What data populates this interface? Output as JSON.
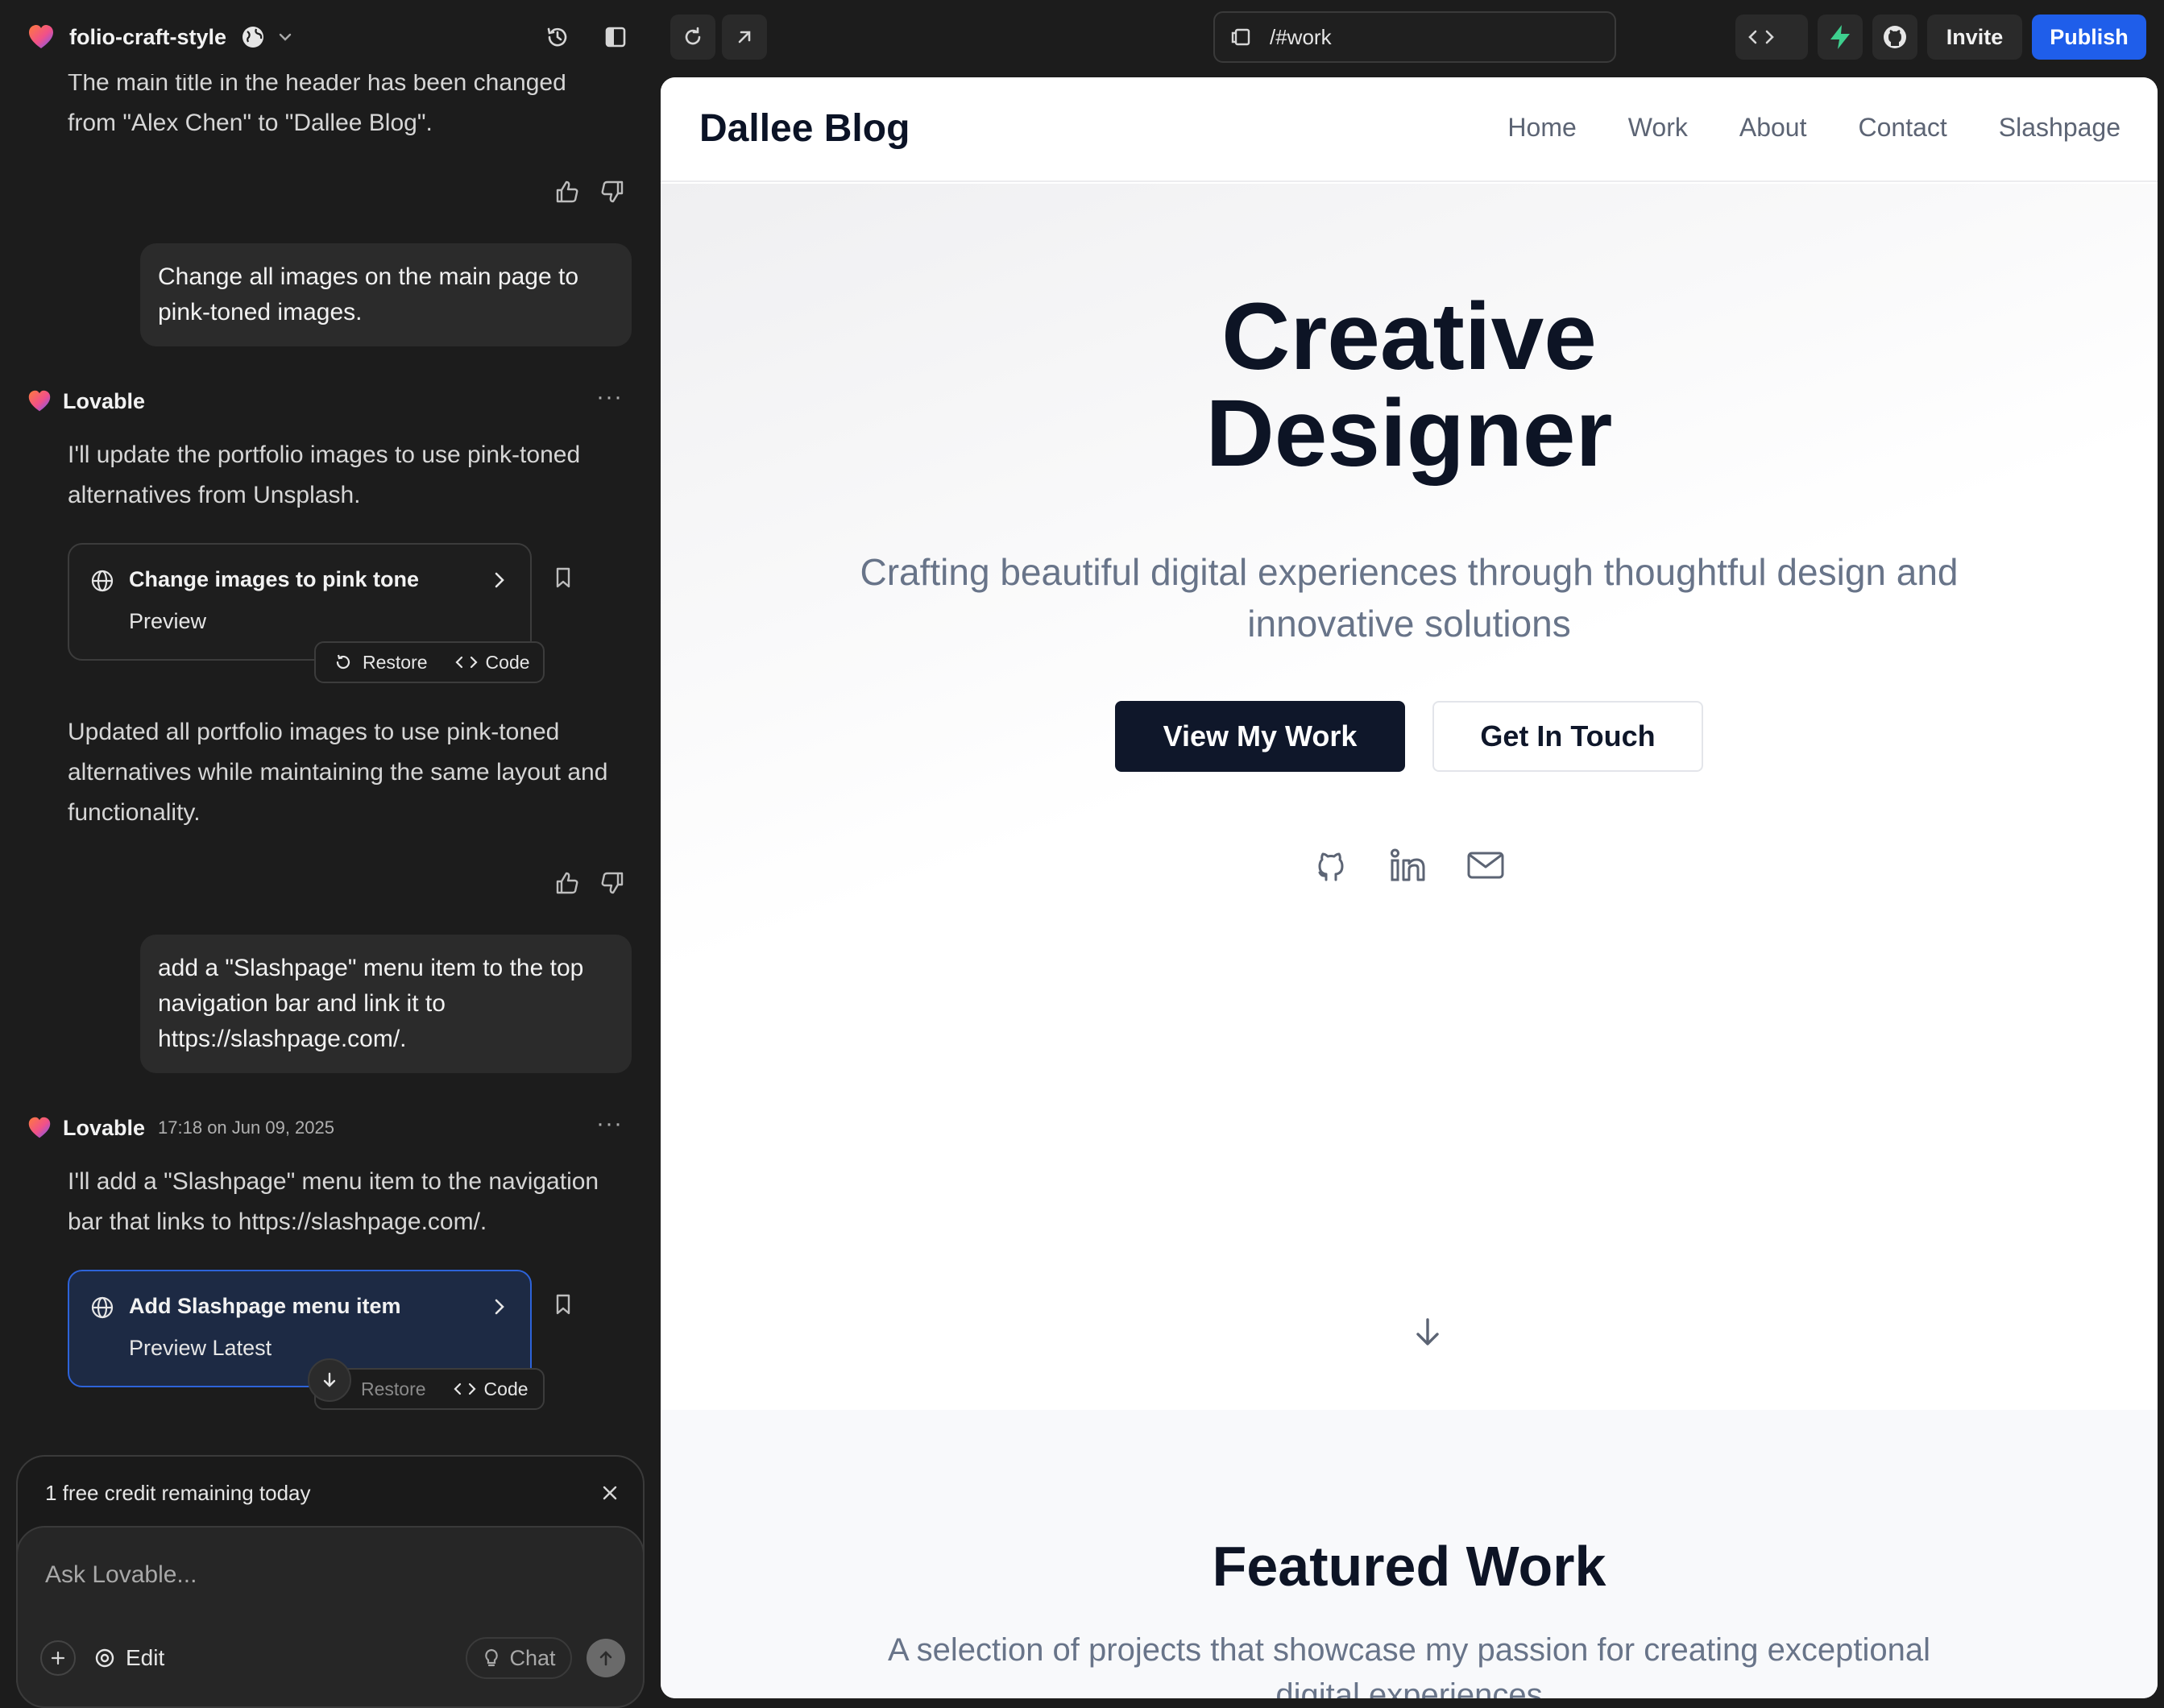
{
  "topbar": {
    "project_name": "folio-craft-style",
    "url": "/#work",
    "invite_label": "Invite",
    "publish_label": "Publish"
  },
  "chat": {
    "partial_message": "The main title in the header has been changed from \"Alex Chen\" to \"Dallee Blog\".",
    "user_msg_1": "Change all images on the main page to pink-toned images.",
    "assistant_1": {
      "author": "Lovable",
      "intro": "I'll update the portfolio images to use pink-toned alternatives from Unsplash.",
      "card_title": "Change images to pink tone",
      "card_sub": "Preview",
      "restore_label": "Restore",
      "code_label": "Code",
      "summary": "Updated all portfolio images to use pink-toned alternatives while maintaining the same layout and functionality."
    },
    "user_msg_2": "add a \"Slashpage\" menu item to the top navigation bar and link it to https://slashpage.com/.",
    "assistant_2": {
      "author": "Lovable",
      "time": "17:18 on Jun 09, 2025",
      "intro": "I'll add a \"Slashpage\" menu item to the navigation bar that links to https://slashpage.com/.",
      "card_title": "Add Slashpage menu item",
      "card_sub": "Preview Latest",
      "restore_label": "Restore",
      "code_label": "Code"
    },
    "credit_notice": "1 free credit remaining today",
    "input_placeholder": "Ask Lovable...",
    "edit_label": "Edit",
    "chat_label": "Chat"
  },
  "preview": {
    "site_title": "Dallee Blog",
    "nav": [
      "Home",
      "Work",
      "About",
      "Contact",
      "Slashpage"
    ],
    "hero_title_line1": "Creative",
    "hero_title_line2": "Designer",
    "hero_subtitle": "Crafting beautiful digital experiences through thoughtful design and innovative solutions",
    "primary_cta": "View My Work",
    "secondary_cta": "Get In Touch",
    "featured_title": "Featured Work",
    "featured_subtitle": "A selection of projects that showcase my passion for creating exceptional digital experiences"
  },
  "colors": {
    "publish": "#1f5eea",
    "supabase_green": "#3ecf8e",
    "dark_bg": "#1c1c1c",
    "active_card": "#1d2a44",
    "hero_button": "#0f172a"
  },
  "icons": [
    "lovable-logo-icon",
    "globe-icon",
    "chevron-down-icon",
    "history-icon",
    "sidebar-toggle-icon",
    "refresh-icon",
    "external-link-icon",
    "device-icon",
    "code-icon",
    "supabase-icon",
    "github-icon",
    "thumbs-up-icon",
    "thumbs-down-icon",
    "more-icon",
    "bookmark-icon",
    "restore-icon",
    "arrow-down-icon",
    "close-icon",
    "plus-icon",
    "edit-target-icon",
    "lightbulb-icon",
    "send-arrow-icon",
    "linkedin-icon",
    "mail-icon"
  ]
}
